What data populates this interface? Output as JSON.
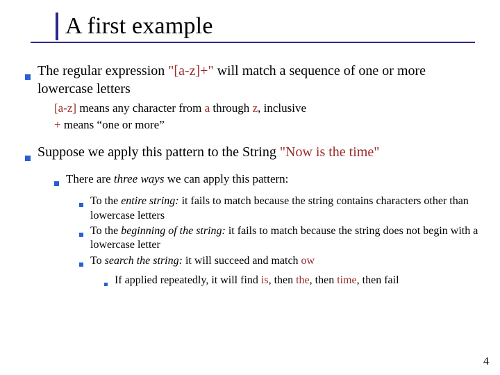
{
  "title": "A first example",
  "page_number": "4",
  "p1": {
    "a": "The regular expression ",
    "code": "\"[a-z]+\"",
    "b": " will match a sequence of one or more lowercase letters"
  },
  "p1s1": {
    "code1": "[a-z]",
    "a": " means any character from ",
    "code2": "a",
    "b": " through ",
    "code3": "z",
    "c": ", inclusive"
  },
  "p1s2": {
    "code1": "+",
    "a": " means “one or more”"
  },
  "p2": {
    "a": "Suppose we apply this pattern to the String ",
    "code": "\"Now is the time\""
  },
  "p2a": {
    "a": "There are ",
    "em": "three ways",
    "b": " we can apply this pattern:"
  },
  "p2a1": {
    "a": "To the ",
    "em": "entire string:",
    "b": " it fails to match because the string contains characters other than lowercase letters"
  },
  "p2a2": {
    "a": "To the ",
    "em": "beginning of the string:",
    "b": " it fails to match because the string does not begin with a lowercase letter"
  },
  "p2a3": {
    "a": "To ",
    "em": "search the string:",
    "b": " it will succeed and match ",
    "code": "ow"
  },
  "p2a3i": {
    "a": "If applied repeatedly, it will find ",
    "c1": "is",
    "b": ", then ",
    "c2": "the",
    "c": ", then ",
    "c3": "time",
    "d": ", then fail"
  }
}
